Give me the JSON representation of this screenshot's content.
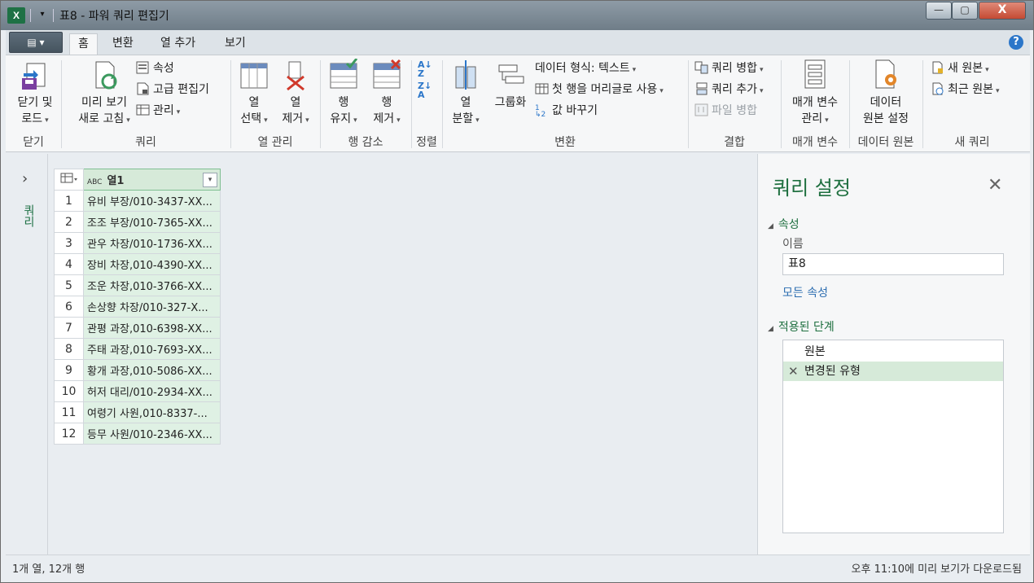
{
  "window": {
    "title": "표8 - 파워 쿼리 편집기",
    "app_icon": "excel-icon",
    "controls": {
      "minimize": "—",
      "maximize": "▢",
      "close": "X"
    }
  },
  "ribbon": {
    "tabs": [
      "홈",
      "변환",
      "열 추가",
      "보기"
    ],
    "active_tab": "홈",
    "groups": {
      "close": {
        "label": "닫기",
        "btn_line1": "닫기 및",
        "btn_line2": "로드"
      },
      "query": {
        "label": "쿼리",
        "preview_line1": "미리 보기",
        "preview_line2": "새로 고침",
        "properties": "속성",
        "advanced": "고급 편집기",
        "manage": "관리"
      },
      "columns": {
        "label": "열 관리",
        "choose_line1": "열",
        "choose_line2": "선택",
        "remove_line1": "열",
        "remove_line2": "제거"
      },
      "rows": {
        "label": "행 감소",
        "keep_line1": "행",
        "keep_line2": "유지",
        "remove_line1": "행",
        "remove_line2": "제거"
      },
      "sort": {
        "label": "정렬"
      },
      "transform": {
        "label": "변환",
        "split_line1": "열",
        "split_line2": "분할",
        "groupby": "그룹화",
        "datatype": "데이터 형식: 텍스트",
        "first_row": "첫 행을 머리글로 사용",
        "replace": "값 바꾸기"
      },
      "combine": {
        "label": "결합",
        "merge": "쿼리 병합",
        "append": "쿼리 추가",
        "merge_files": "파일 병합"
      },
      "params": {
        "label": "매개 변수",
        "manage_line1": "매개 변수",
        "manage_line2": "관리"
      },
      "datasource": {
        "label": "데이터 원본",
        "settings_line1": "데이터",
        "settings_line2": "원본 설정"
      },
      "newquery": {
        "label": "새 쿼리",
        "new_source": "새 원본",
        "recent_source": "최근 원본"
      }
    }
  },
  "nav": {
    "label": "쿼리"
  },
  "grid": {
    "column_header": "열1",
    "type_badge": "ABC",
    "rows": [
      {
        "n": "1",
        "v": "유비 부장/010-3437-XX..."
      },
      {
        "n": "2",
        "v": "조조 부장/010-7365-XX..."
      },
      {
        "n": "3",
        "v": "관우 차장/010-1736-XX..."
      },
      {
        "n": "4",
        "v": "장비 차장,010-4390-XX..."
      },
      {
        "n": "5",
        "v": "조운 차장,010-3766-XX..."
      },
      {
        "n": "6",
        "v": "손상향 차장/010-327-X..."
      },
      {
        "n": "7",
        "v": "관평 과장,010-6398-XX..."
      },
      {
        "n": "8",
        "v": "주태 과장,010-7693-XX..."
      },
      {
        "n": "9",
        "v": "황개 과장,010-5086-XX..."
      },
      {
        "n": "10",
        "v": "허저 대리/010-2934-XX..."
      },
      {
        "n": "11",
        "v": "여령기 사원,010-8337-..."
      },
      {
        "n": "12",
        "v": "등무 사원/010-2346-XX..."
      }
    ]
  },
  "settings": {
    "title": "쿼리 설정",
    "properties_section": "속성",
    "name_label": "이름",
    "name_value": "표8",
    "all_properties": "모든 속성",
    "steps_section": "적용된 단계",
    "steps": [
      "원본",
      "변경된 유형"
    ],
    "selected_step": "변경된 유형"
  },
  "status": {
    "left": "1개 열, 12개 행",
    "right": "오후 11:10에 미리 보기가 다운로드됨"
  }
}
